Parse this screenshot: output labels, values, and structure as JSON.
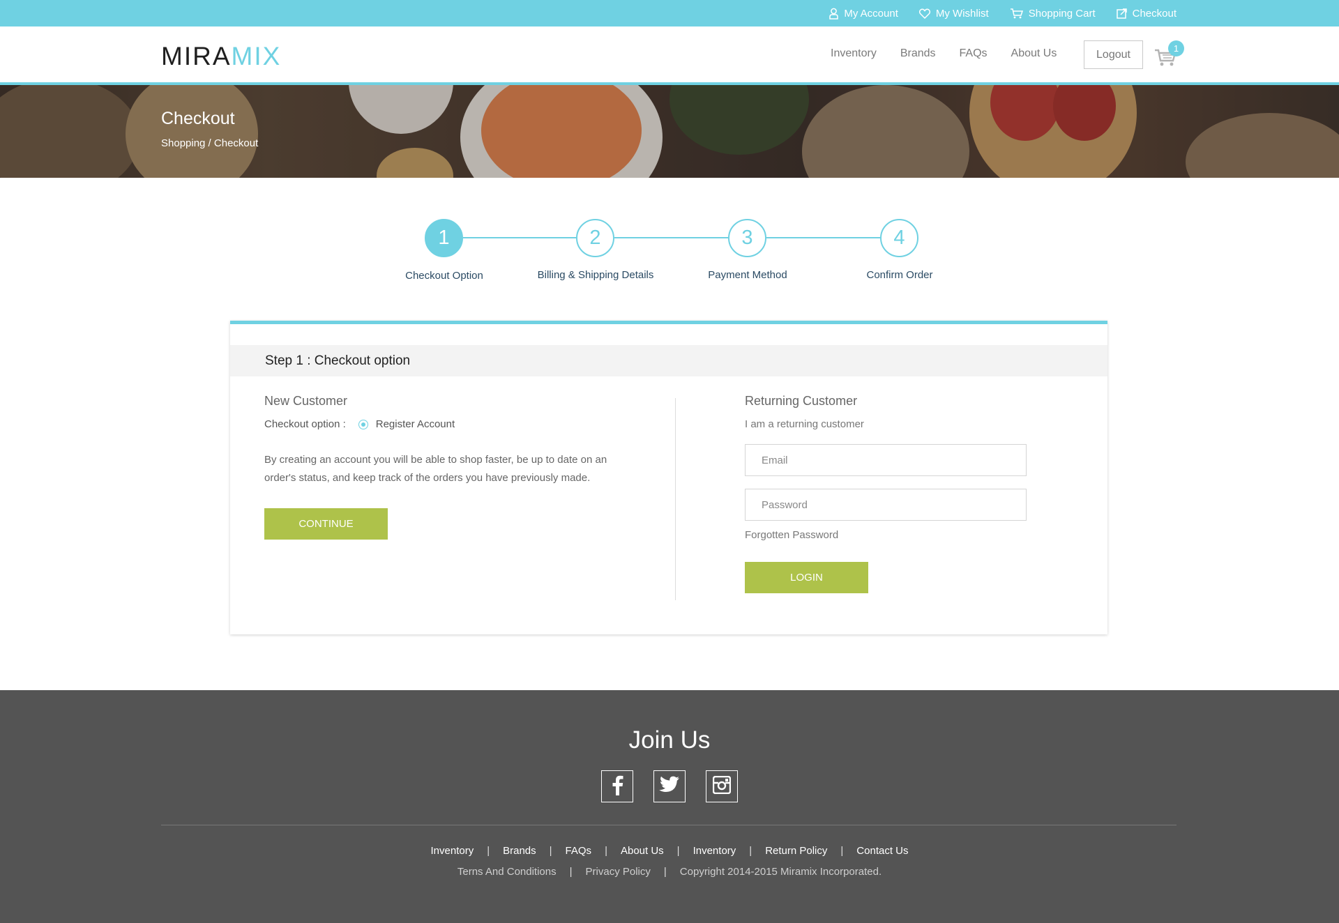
{
  "topbar": {
    "links": [
      {
        "label": "My Account",
        "icon": "user-icon"
      },
      {
        "label": "My Wishlist",
        "icon": "heart-icon"
      },
      {
        "label": "Shopping Cart",
        "icon": "cart-icon"
      },
      {
        "label": "Checkout",
        "icon": "checkout-icon"
      }
    ]
  },
  "header": {
    "logo_part1": "MIRA",
    "logo_part2": "MIX",
    "nav": [
      "Inventory",
      "Brands",
      "FAQs",
      "About Us"
    ],
    "logout_label": "Logout",
    "cart_count": "1"
  },
  "banner": {
    "title": "Checkout",
    "breadcrumb": "Shopping / Checkout"
  },
  "stepper": {
    "steps": [
      {
        "number": "1",
        "label": "Checkout Option"
      },
      {
        "number": "2",
        "label": "Billing & Shipping Details"
      },
      {
        "number": "3",
        "label": "Payment Method"
      },
      {
        "number": "4",
        "label": "Confirm Order"
      }
    ]
  },
  "checkout": {
    "heading": "Step 1 :  Checkout option",
    "new_customer": {
      "title": "New Customer",
      "option_label": "Checkout option :",
      "radio_label": "Register Account",
      "description": "By creating an account you will be able to shop faster, be up to date on an order's status, and keep track of the orders you have previously made.",
      "button": "CONTINUE"
    },
    "returning_customer": {
      "title": "Returning Customer",
      "subtitle": "I am a returning customer",
      "email_placeholder": "Email",
      "password_placeholder": "Password",
      "forgot": "Forgotten Password",
      "button": "LOGIN"
    }
  },
  "footer": {
    "join": "Join Us",
    "social": [
      "facebook-icon",
      "twitter-icon",
      "instagram-icon"
    ],
    "links": [
      "Inventory",
      "Brands",
      "FAQs",
      "About Us",
      "Inventory",
      "Return Policy",
      "Contact Us"
    ],
    "legal": [
      "Terns And Conditions",
      "Privacy Policy",
      "Copyright 2014-2015 Miramix Incorporated."
    ]
  },
  "colors": {
    "accent": "#6fd1e2",
    "button_green": "#aec24a",
    "footer_bg": "#545454"
  }
}
